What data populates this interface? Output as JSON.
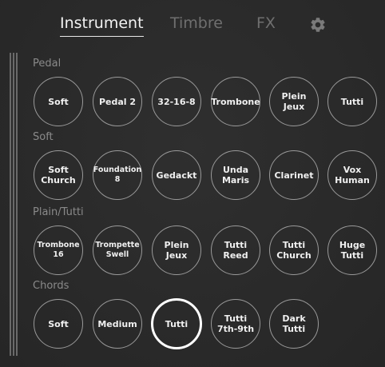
{
  "tabs": {
    "instrument": "Instrument",
    "timbre": "Timbre",
    "fx": "FX",
    "settings_icon": "gear-icon"
  },
  "sections": [
    {
      "label": "Pedal",
      "buttons": [
        "Soft",
        "Pedal 2",
        "32-16-8",
        "Trombone",
        "Plein Jeux",
        "Tutti"
      ]
    },
    {
      "label": "Soft",
      "buttons": [
        "Soft\nChurch",
        "Foundation\n8",
        "Gedackt",
        "Unda\nMaris",
        "Clarinet",
        "Vox\nHuman"
      ]
    },
    {
      "label": "Plain/Tutti",
      "buttons": [
        "Trombone\n16",
        "Trompette\nSwell",
        "Plein\nJeux",
        "Tutti\nReed",
        "Tutti\nChurch",
        "Huge\nTutti"
      ]
    },
    {
      "label": "Chords",
      "buttons": [
        "Soft",
        "Medium",
        "Tutti",
        "Tutti\n7th-9th",
        "Dark\nTutti"
      ],
      "selected_index": 2
    }
  ],
  "colors": {
    "background": "#2b2b2b",
    "active_tab": "#f2f2f2",
    "inactive_tab": "#6f6f6f",
    "section_label": "#8a8a8a",
    "button_border": "#9a9a9a",
    "selected_border": "#ffffff"
  }
}
